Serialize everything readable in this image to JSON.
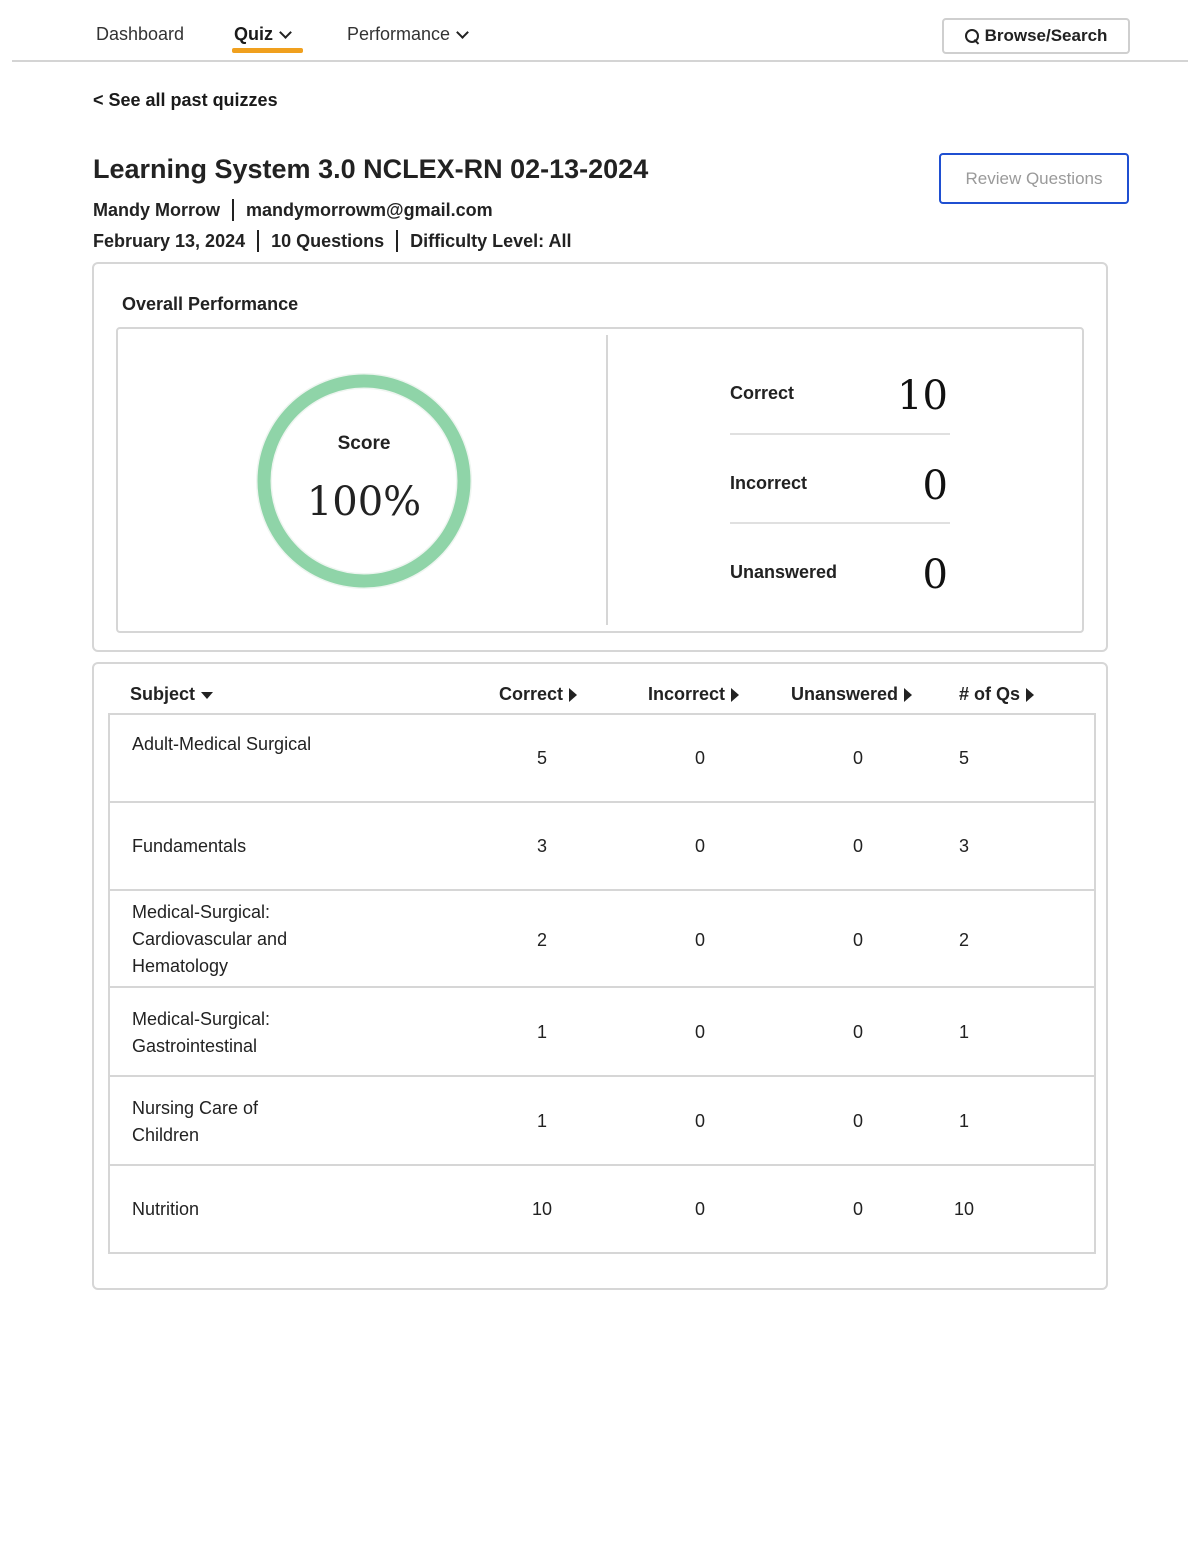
{
  "nav": {
    "dashboard": "Dashboard",
    "quiz": "Quiz",
    "performance": "Performance",
    "search": "Browse/Search"
  },
  "back_link": "< See all past quizzes",
  "quiz": {
    "title": "Learning System 3.0 NCLEX-RN 02-13-2024",
    "user_name": "Mandy Morrow",
    "user_email": "mandymorrowm@gmail.com",
    "date": "February 13, 2024",
    "question_count": "10 Questions",
    "difficulty": "Difficulty Level: All"
  },
  "review_button": "Review Questions",
  "overall": {
    "title": "Overall Performance",
    "score_label": "Score",
    "score_value": "100%",
    "score_fraction": 1.0,
    "correct_label": "Correct",
    "correct_value": "10",
    "incorrect_label": "Incorrect",
    "incorrect_value": "0",
    "unanswered_label": "Unanswered",
    "unanswered_value": "0"
  },
  "table": {
    "headers": {
      "subject": "Subject",
      "correct": "Correct",
      "incorrect": "Incorrect",
      "unanswered": "Unanswered",
      "num_qs": "# of Qs"
    },
    "rows": [
      {
        "subject": "Adult-Medical Surgical",
        "correct": "5",
        "incorrect": "0",
        "unanswered": "0",
        "num_qs": "5"
      },
      {
        "subject": "Fundamentals",
        "correct": "3",
        "incorrect": "0",
        "unanswered": "0",
        "num_qs": "3"
      },
      {
        "subject": "Medical-Surgical: Cardiovascular and Hematology",
        "correct": "2",
        "incorrect": "0",
        "unanswered": "0",
        "num_qs": "2"
      },
      {
        "subject": "Medical-Surgical: Gastrointestinal",
        "correct": "1",
        "incorrect": "0",
        "unanswered": "0",
        "num_qs": "1"
      },
      {
        "subject": "Nursing Care of Children",
        "correct": "1",
        "incorrect": "0",
        "unanswered": "0",
        "num_qs": "1"
      },
      {
        "subject": "Nutrition",
        "correct": "10",
        "incorrect": "0",
        "unanswered": "0",
        "num_qs": "10"
      }
    ]
  },
  "colors": {
    "accent_underline": "#f0a01e",
    "review_border": "#1f4fd1",
    "score_ring": "#8fd4a8"
  }
}
